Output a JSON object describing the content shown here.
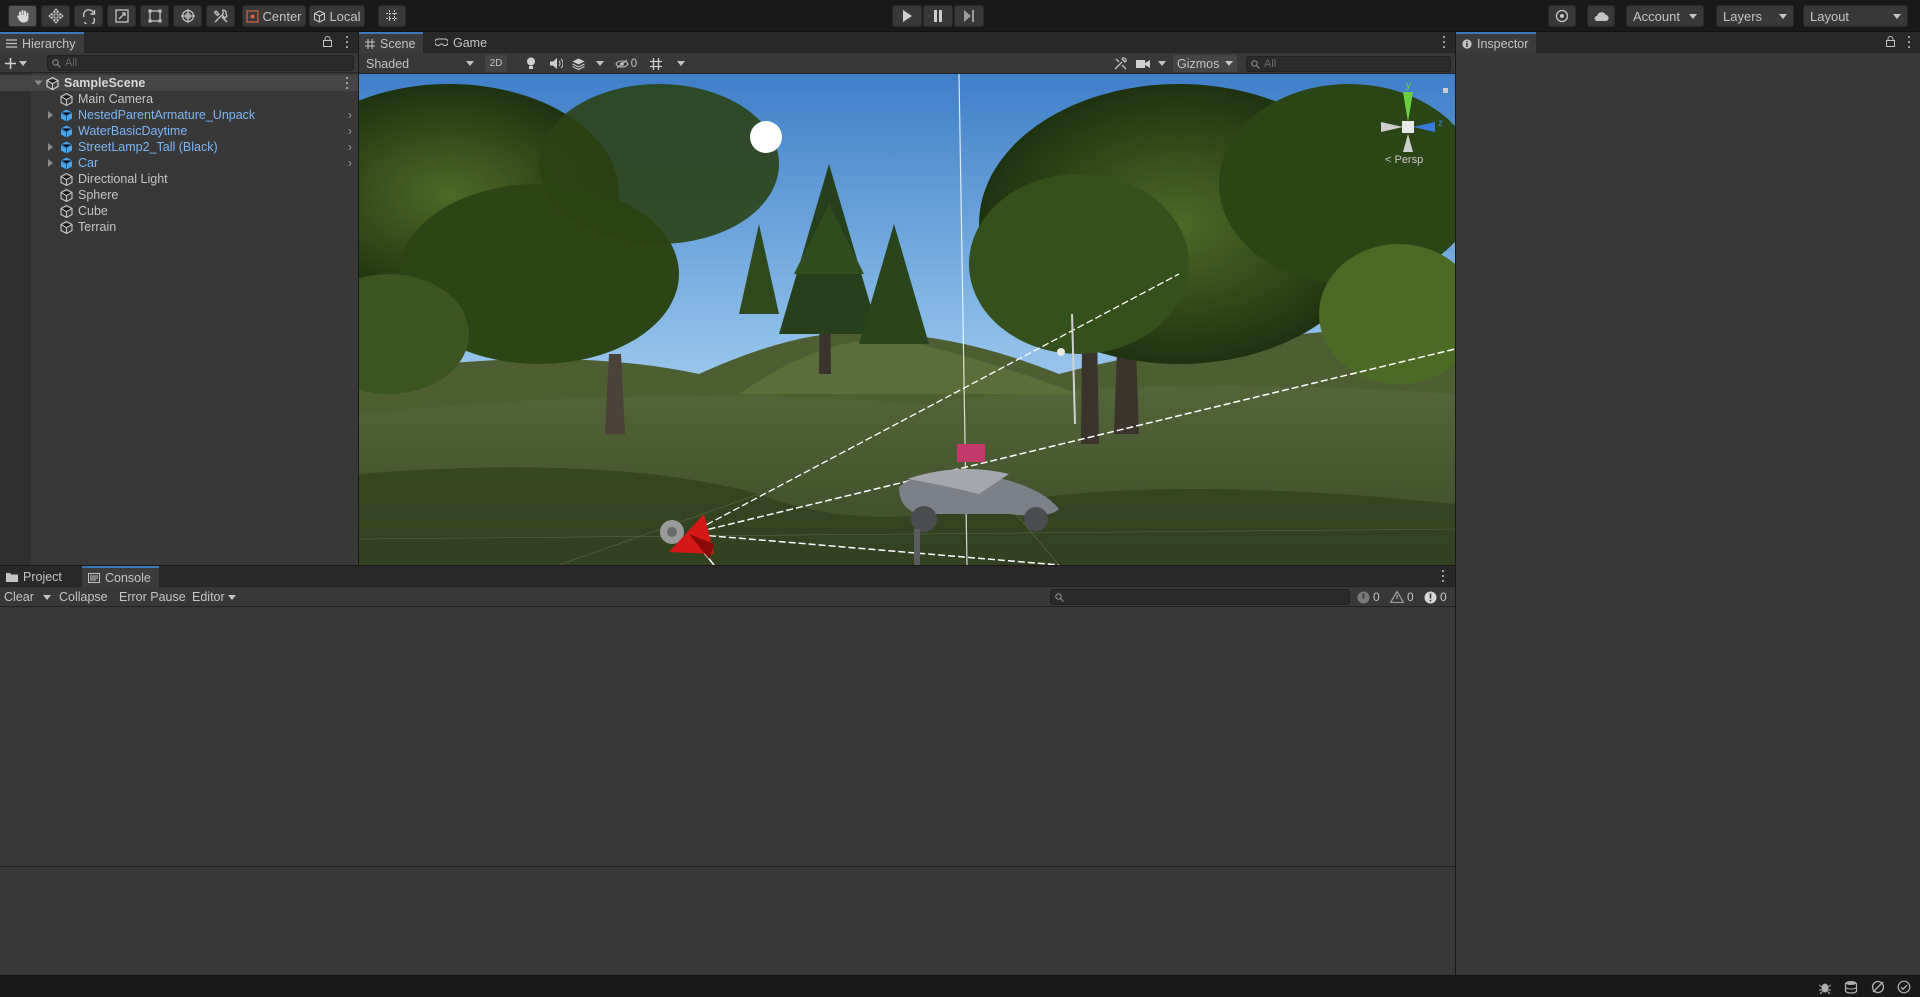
{
  "toolbar": {
    "tools": [
      "hand-tool-icon",
      "move-tool-icon",
      "rotate-tool-icon",
      "scale-tool-icon",
      "rect-tool-icon",
      "transform-tool-icon",
      "custom-tool-icon"
    ],
    "pivot_mode": "Center",
    "pivot_rotation": "Local",
    "account_label": "Account",
    "layers_label": "Layers",
    "layout_label": "Layout"
  },
  "hierarchy": {
    "tab_label": "Hierarchy",
    "search_placeholder": "All",
    "scene_name": "SampleScene",
    "items": [
      {
        "label": "Main Camera",
        "prefab": false,
        "expandable": false
      },
      {
        "label": "NestedParentArmature_Unpack",
        "prefab": true,
        "expandable": true
      },
      {
        "label": "WaterBasicDaytime",
        "prefab": true,
        "expandable": false
      },
      {
        "label": "StreetLamp2_Tall (Black)",
        "prefab": true,
        "expandable": true
      },
      {
        "label": "Car",
        "prefab": true,
        "expandable": true
      },
      {
        "label": "Directional Light",
        "prefab": false,
        "expandable": false
      },
      {
        "label": "Sphere",
        "prefab": false,
        "expandable": false
      },
      {
        "label": "Cube",
        "prefab": false,
        "expandable": false
      },
      {
        "label": "Terrain",
        "prefab": false,
        "expandable": false
      }
    ]
  },
  "scene": {
    "tab_scene": "Scene",
    "tab_game": "Game",
    "draw_mode": "Shaded",
    "mode_2d": "2D",
    "hidden_count": "0",
    "gizmos_label": "Gizmos",
    "search_placeholder": "All",
    "projection_label": "< Persp",
    "axis_y": "y",
    "axis_z": "z"
  },
  "console": {
    "tab_project": "Project",
    "tab_console": "Console",
    "clear_label": "Clear",
    "collapse_label": "Collapse",
    "error_pause_label": "Error Pause",
    "editor_label": "Editor",
    "log_count": "0",
    "warning_count": "0",
    "error_count": "0"
  },
  "inspector": {
    "tab_label": "Inspector"
  },
  "colors": {
    "accent": "#3a79bb",
    "prefab_text": "#7cb5f4",
    "panel_bg": "#383838",
    "chrome_bg": "#191919"
  }
}
